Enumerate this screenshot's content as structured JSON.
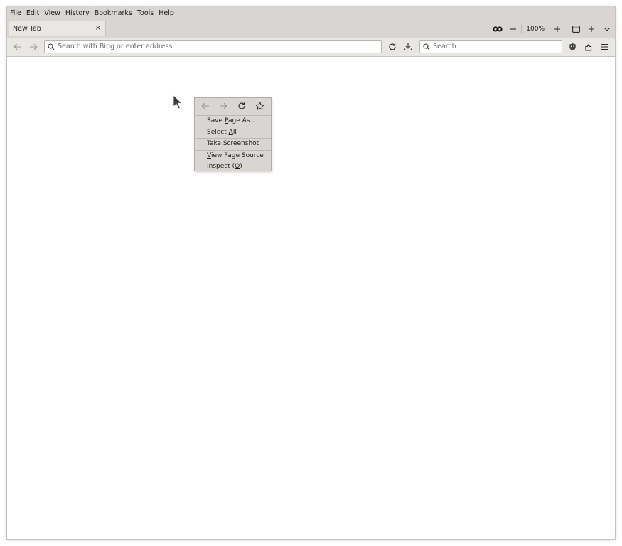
{
  "menubar": {
    "items": [
      {
        "pre": "",
        "accel": "F",
        "post": "ile"
      },
      {
        "pre": "",
        "accel": "E",
        "post": "dit"
      },
      {
        "pre": "",
        "accel": "V",
        "post": "iew"
      },
      {
        "pre": "Hi",
        "accel": "s",
        "post": "tory"
      },
      {
        "pre": "",
        "accel": "B",
        "post": "ookmarks"
      },
      {
        "pre": "",
        "accel": "T",
        "post": "ools"
      },
      {
        "pre": "",
        "accel": "H",
        "post": "elp"
      }
    ]
  },
  "tab": {
    "title": "New Tab",
    "close": "×"
  },
  "toolbar": {
    "zoom": "100%"
  },
  "urlbar": {
    "placeholder": "Search with Bing or enter address"
  },
  "searchbar": {
    "placeholder": "Search"
  },
  "context_menu": {
    "items": [
      {
        "pre": "Save ",
        "accel": "P",
        "post": "age As…"
      },
      {
        "pre": "Select ",
        "accel": "A",
        "post": "ll"
      },
      {
        "pre": "",
        "accel": "T",
        "post": "ake Screenshot"
      },
      {
        "pre": "",
        "accel": "V",
        "post": "iew Page Source"
      },
      {
        "pre": "Inspect (",
        "accel": "Q",
        "post": ")"
      }
    ]
  },
  "colors": {
    "chrome": "#d8d5d2",
    "toolbar": "#e9e7e4",
    "page": "#ffffff",
    "icon": "#2a2a2a",
    "disabled": "#9a9896"
  },
  "icons": [
    "back-icon",
    "forward-icon",
    "reload-icon",
    "download-icon",
    "search-icon",
    "shield-icon",
    "extensions-icon",
    "menu-icon",
    "private-mask-icon",
    "zoom-out-icon",
    "zoom-in-icon",
    "sidebar-icon",
    "new-tab-icon",
    "tab-list-icon",
    "bookmark-star-icon",
    "mouse-pointer-icon"
  ]
}
